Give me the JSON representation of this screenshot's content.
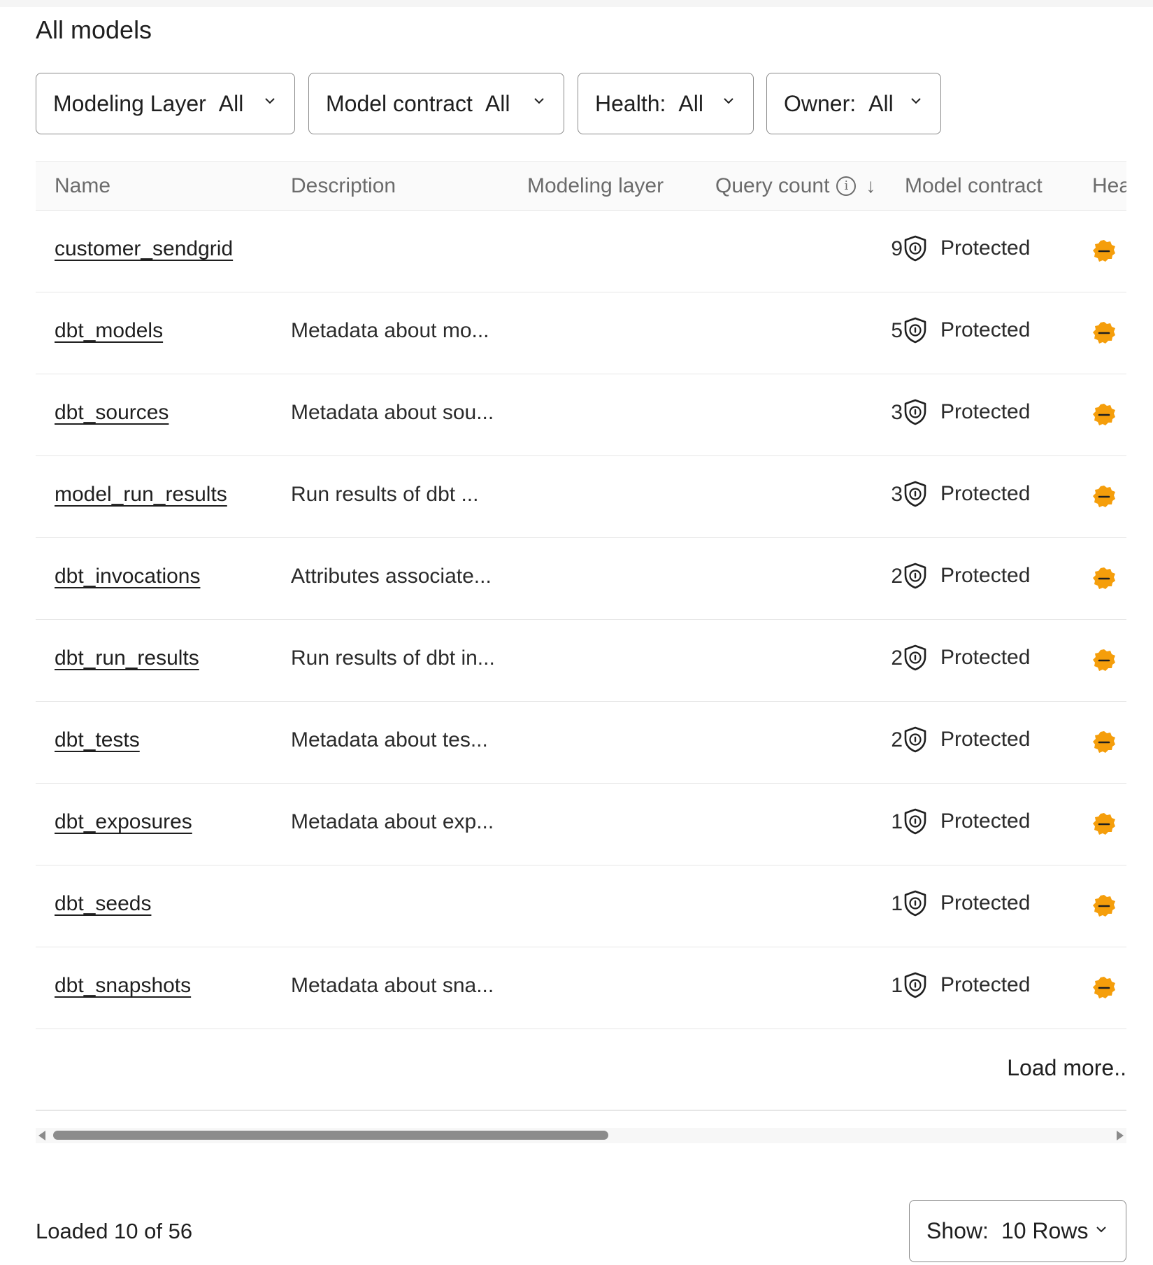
{
  "page": {
    "title": "All models"
  },
  "filters": [
    {
      "label": "Modeling Layer",
      "value": "All"
    },
    {
      "label": "Model contract",
      "value": "All"
    },
    {
      "label": "Health:",
      "value": "All"
    },
    {
      "label": "Owner:",
      "value": "All"
    }
  ],
  "table": {
    "columns": {
      "name": "Name",
      "description": "Description",
      "modeling_layer": "Modeling layer",
      "query_count": "Query count",
      "model_contract": "Model contract",
      "health": "Hea"
    },
    "sort": {
      "column": "query_count",
      "direction": "desc",
      "icon": "arrow-down-icon"
    },
    "rows": [
      {
        "name": "customer_sendgrid",
        "description": "",
        "modeling_layer": "",
        "query_count": "9",
        "contract": "Protected",
        "health": "warning"
      },
      {
        "name": "dbt_models",
        "description": "Metadata about mo...",
        "modeling_layer": "",
        "query_count": "5",
        "contract": "Protected",
        "health": "warning"
      },
      {
        "name": "dbt_sources",
        "description": "Metadata about sou...",
        "modeling_layer": "",
        "query_count": "3",
        "contract": "Protected",
        "health": "warning"
      },
      {
        "name": "model_run_results",
        "description": "Run results of dbt ...",
        "modeling_layer": "",
        "query_count": "3",
        "contract": "Protected",
        "health": "warning"
      },
      {
        "name": "dbt_invocations",
        "description": "Attributes associate...",
        "modeling_layer": "",
        "query_count": "2",
        "contract": "Protected",
        "health": "warning"
      },
      {
        "name": "dbt_run_results",
        "description": "Run results of dbt in...",
        "modeling_layer": "",
        "query_count": "2",
        "contract": "Protected",
        "health": "warning"
      },
      {
        "name": "dbt_tests",
        "description": "Metadata about tes...",
        "modeling_layer": "",
        "query_count": "2",
        "contract": "Protected",
        "health": "warning"
      },
      {
        "name": "dbt_exposures",
        "description": "Metadata about exp...",
        "modeling_layer": "",
        "query_count": "1",
        "contract": "Protected",
        "health": "warning"
      },
      {
        "name": "dbt_seeds",
        "description": "",
        "modeling_layer": "",
        "query_count": "1",
        "contract": "Protected",
        "health": "warning"
      },
      {
        "name": "dbt_snapshots",
        "description": "Metadata about sna...",
        "modeling_layer": "",
        "query_count": "1",
        "contract": "Protected",
        "health": "warning"
      }
    ],
    "load_more": "Load more.."
  },
  "scroll": {
    "horizontal_position": 0,
    "visible_fraction": 0.51
  },
  "footer": {
    "status": "Loaded 10 of 56",
    "show_label": "Show:",
    "show_value": "10 Rows"
  },
  "colors": {
    "health_warning": "#f59e0b",
    "border": "#8a8a8a",
    "header_text": "#6b6b6b"
  }
}
